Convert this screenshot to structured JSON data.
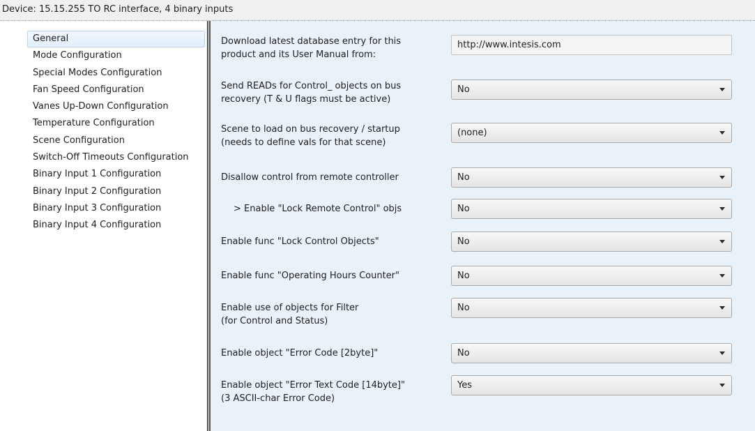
{
  "window": {
    "title": "Device: 15.15.255  TO RC interface, 4 binary inputs"
  },
  "sidebar": {
    "items": [
      {
        "label": "General",
        "selected": true
      },
      {
        "label": "Mode Configuration"
      },
      {
        "label": "Special Modes Configuration"
      },
      {
        "label": "Fan Speed Configuration"
      },
      {
        "label": "Vanes Up-Down Configuration"
      },
      {
        "label": "Temperature Configuration"
      },
      {
        "label": "Scene Configuration"
      },
      {
        "label": "Switch-Off Timeouts Configuration"
      },
      {
        "label": "Binary Input 1 Configuration"
      },
      {
        "label": "Binary Input 2 Configuration"
      },
      {
        "label": "Binary Input 3 Configuration"
      },
      {
        "label": "Binary Input 4 Configuration"
      }
    ]
  },
  "params": [
    {
      "label": "Download latest database entry for this product and its User Manual from:",
      "value": "http://www.intesis.com",
      "type": "text"
    },
    {
      "label": "Send READs for Control_ objects on bus recovery (T & U flags must be active)",
      "value": "No",
      "type": "select"
    },
    {
      "label": "Scene to load on bus recovery / startup (needs to define vals for that scene)",
      "value": "(none)",
      "type": "select"
    },
    {
      "label": "Disallow control from remote controller",
      "value": "No",
      "type": "select"
    },
    {
      "label": "> Enable \"Lock Remote Control\" objs",
      "value": "No",
      "type": "select"
    },
    {
      "label": "Enable func \"Lock Control Objects\"",
      "value": "No",
      "type": "select"
    },
    {
      "label": "Enable func \"Operating Hours Counter\"",
      "value": "No",
      "type": "select"
    },
    {
      "label": "Enable use of objects for Filter\n(for Control and Status)",
      "value": "No",
      "type": "select"
    },
    {
      "label": "Enable object \"Error Code [2byte]\"",
      "value": "No",
      "type": "select"
    },
    {
      "label": "Enable object \"Error Text Code [14byte]\"\n(3 ASCII-char Error Code)",
      "value": "Yes",
      "type": "select"
    }
  ],
  "icons": {
    "dropdown": "chevron-down-icon"
  }
}
